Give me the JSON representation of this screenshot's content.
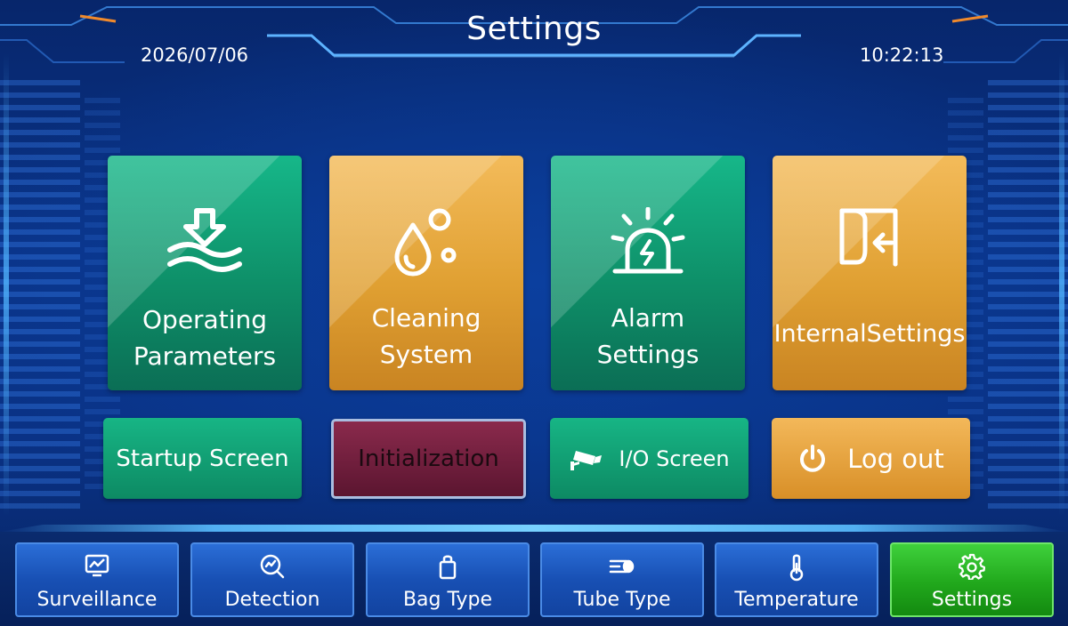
{
  "header": {
    "title": "Settings",
    "date": "2026/07/06",
    "time": "10:22:13"
  },
  "tiles": [
    {
      "label_line1": "Operating",
      "label_line2": "Parameters",
      "icon": "water-level-down-icon",
      "color": "#12a57c"
    },
    {
      "label_line1": "Cleaning",
      "label_line2": "System",
      "icon": "water-drops-icon",
      "color": "#e5a43a"
    },
    {
      "label_line1": "Alarm",
      "label_line2": "Settings",
      "icon": "alarm-siren-icon",
      "color": "#12a57c"
    },
    {
      "label_line1": "InternalSettings",
      "icon": "login-door-icon",
      "color": "#e5a43a"
    }
  ],
  "buttons": [
    {
      "label": "Startup Screen",
      "color": "#12a57c"
    },
    {
      "label": "Initialization",
      "color": "#6e1d3c"
    },
    {
      "label": "I/O Screen",
      "icon": "camera-icon",
      "color": "#12a57c"
    },
    {
      "label": "Log out",
      "icon": "power-icon",
      "color": "#e5a43a"
    }
  ],
  "nav": [
    {
      "label": "Surveillance",
      "icon": "monitor-chart-icon"
    },
    {
      "label": "Detection",
      "icon": "search-chart-icon"
    },
    {
      "label": "Bag Type",
      "icon": "bag-icon"
    },
    {
      "label": "Tube Type",
      "icon": "tube-icon"
    },
    {
      "label": "Temperature",
      "icon": "thermometer-icon"
    },
    {
      "label": "Settings",
      "icon": "gear-icon",
      "active": true
    }
  ]
}
